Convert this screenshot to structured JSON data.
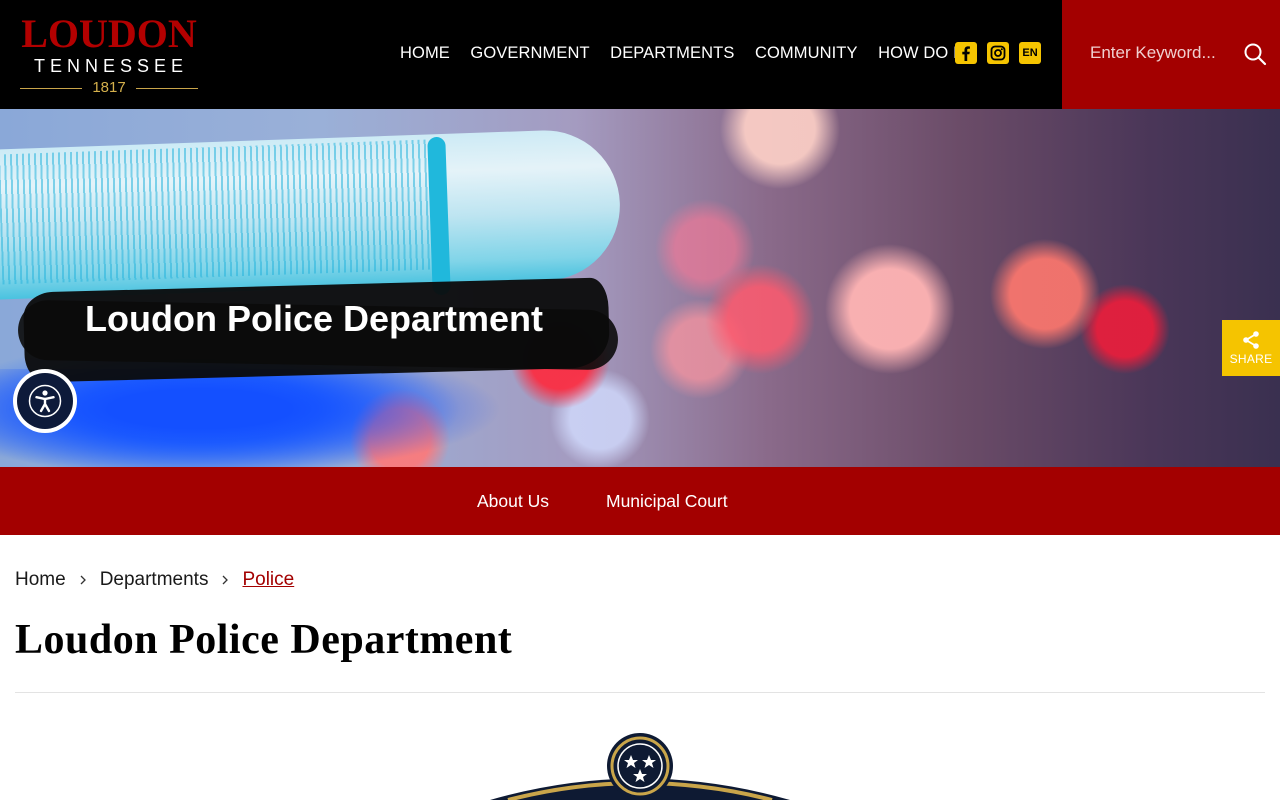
{
  "header": {
    "logo": {
      "main": "LOUDON",
      "sub": "TENNESSEE",
      "year": "1817"
    },
    "nav": [
      {
        "label": "HOME"
      },
      {
        "label": "GOVERNMENT"
      },
      {
        "label": "DEPARTMENTS"
      },
      {
        "label": "COMMUNITY"
      },
      {
        "label": "HOW DO I"
      }
    ],
    "social": {
      "facebook_icon": "facebook-icon",
      "instagram_icon": "instagram-icon",
      "language_label": "EN"
    },
    "search": {
      "placeholder": "Enter Keyword...",
      "icon": "search-icon"
    }
  },
  "hero": {
    "title": "Loudon Police Department"
  },
  "share": {
    "label": "SHARE"
  },
  "subnav": [
    {
      "label": "About Us"
    },
    {
      "label": "Municipal Court"
    }
  ],
  "breadcrumb": [
    {
      "label": "Home"
    },
    {
      "label": "Departments"
    },
    {
      "label": "Police"
    }
  ],
  "page": {
    "title": "Loudon Police Department"
  },
  "colors": {
    "brand_red": "#a30000",
    "accent_yellow": "#f5c400",
    "header_black": "#000000"
  }
}
